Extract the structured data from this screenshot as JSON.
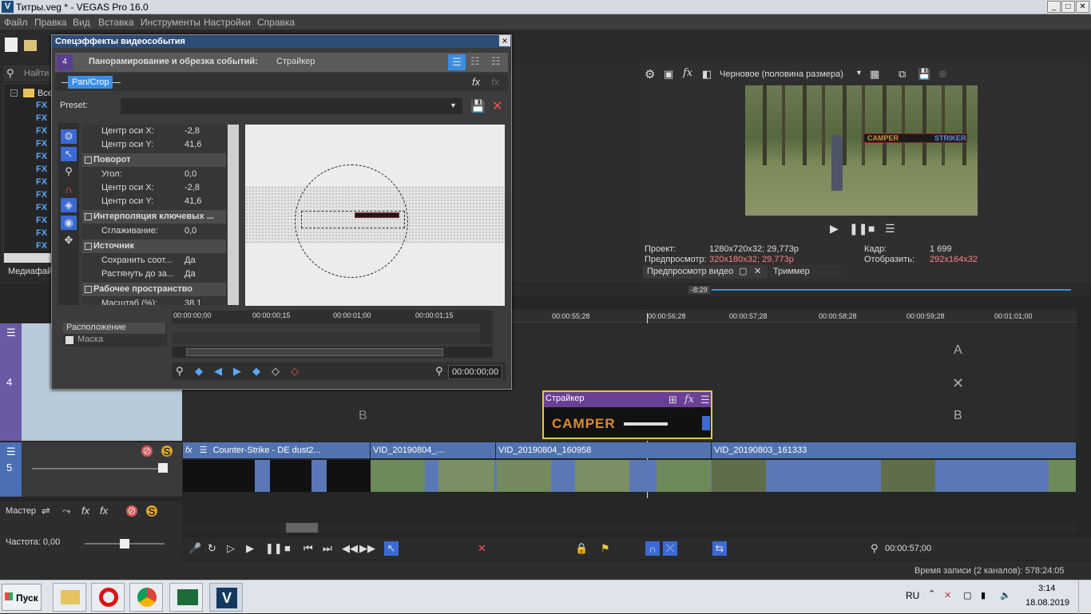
{
  "app": {
    "title": "Титры.veg * - VEGAS Pro 16.0",
    "logo_letter": "V",
    "window_buttons": [
      "_",
      "□",
      "✕"
    ]
  },
  "menu": [
    "Файл",
    "Правка",
    "Вид",
    "Вставка",
    "Инструменты",
    "Настройки",
    "Справка"
  ],
  "explorer": {
    "search_placeholder": "Найти",
    "root_label": "Все",
    "items": [
      "FX",
      "FX",
      "FX",
      "FX",
      "FX",
      "FX",
      "FX",
      "FX",
      "FX",
      "FX",
      "FX",
      "FX"
    ],
    "bottom_tab": "Медиафай"
  },
  "dialog": {
    "title": "Спецэффекты видеособытия",
    "close": "×",
    "header": "Панорамирование и обрезка событий:",
    "header_event": "Стрaйкер",
    "chain_button": "Pan/Crop",
    "preset_label": "Preset:",
    "preset_value": "",
    "props": [
      {
        "type": "row",
        "label": "Центр оси X:",
        "value": "-2,8"
      },
      {
        "type": "row",
        "label": "Центр оси Y:",
        "value": "41,6"
      },
      {
        "type": "section",
        "label": "Поворот"
      },
      {
        "type": "row",
        "label": "Угол:",
        "value": "0,0"
      },
      {
        "type": "row",
        "label": "Центр оси X:",
        "value": "-2,8"
      },
      {
        "type": "row",
        "label": "Центр оси Y:",
        "value": "41,6"
      },
      {
        "type": "section",
        "label": "Интерполяция ключевых ..."
      },
      {
        "type": "row",
        "label": "Сглаживание:",
        "value": "0,0"
      },
      {
        "type": "section",
        "label": "Источник"
      },
      {
        "type": "row",
        "label": "Сохранить соот...",
        "value": "Да"
      },
      {
        "type": "row",
        "label": "Растянуть до за...",
        "value": "Да"
      },
      {
        "type": "section",
        "label": "Рабочее пространство"
      },
      {
        "type": "row",
        "label": "Масштаб (%):",
        "value": "38,1"
      }
    ],
    "kf_tracks": [
      "Расположение",
      "Маска"
    ],
    "kf_ruler": [
      "00:00:00;00",
      "00:00:00;15",
      "00:00:01;00",
      "00:00:01;15"
    ],
    "timecode": "00:00:00;00"
  },
  "preview": {
    "quality": "Черновое (половина размера)",
    "overlay_left": "CAMPER",
    "overlay_right": "STRIKER",
    "info": {
      "project_label": "Проект:",
      "project_value": "1280x720x32; 29,773p",
      "preview_label": "Предпросмотр:",
      "preview_value": "320x180x32; 29,773p",
      "frame_label": "Кадр:",
      "frame_value": "1 699",
      "display_label": "Отобразить:",
      "display_value": "292x164x32"
    },
    "tabs": [
      "Предпросмотр видео",
      "Триммер"
    ]
  },
  "timeline": {
    "marker": "-8:29",
    "ruler": [
      "00:00:55;28",
      "00:00:56;28",
      "00:00:57;28",
      "00:00:58;28",
      "00:00:59;28",
      "00:01:01;00"
    ],
    "track4_number": "4",
    "track5_number": "5",
    "labels_a": "A",
    "labels_b": "B",
    "event_title": "Стрaйкер",
    "event_text": "CAMPER",
    "clips": [
      "Counter-Strike - DE dust2...",
      "VID_20190804_...",
      "VID_20190804_160958",
      "VID_20190803_161333"
    ],
    "master_label": "Мастер",
    "rate_label": "Частота: 0,00",
    "time_display": "00:00:57;00",
    "status": "Время записи (2 каналов): 578:24:05"
  },
  "taskbar": {
    "start": "Пуск",
    "lang": "RU",
    "time": "3:14",
    "date": "18.08.2019"
  },
  "colors": {
    "accent": "#3a8ee6",
    "clip": "#5173b0",
    "text_red": "#ff8080"
  }
}
